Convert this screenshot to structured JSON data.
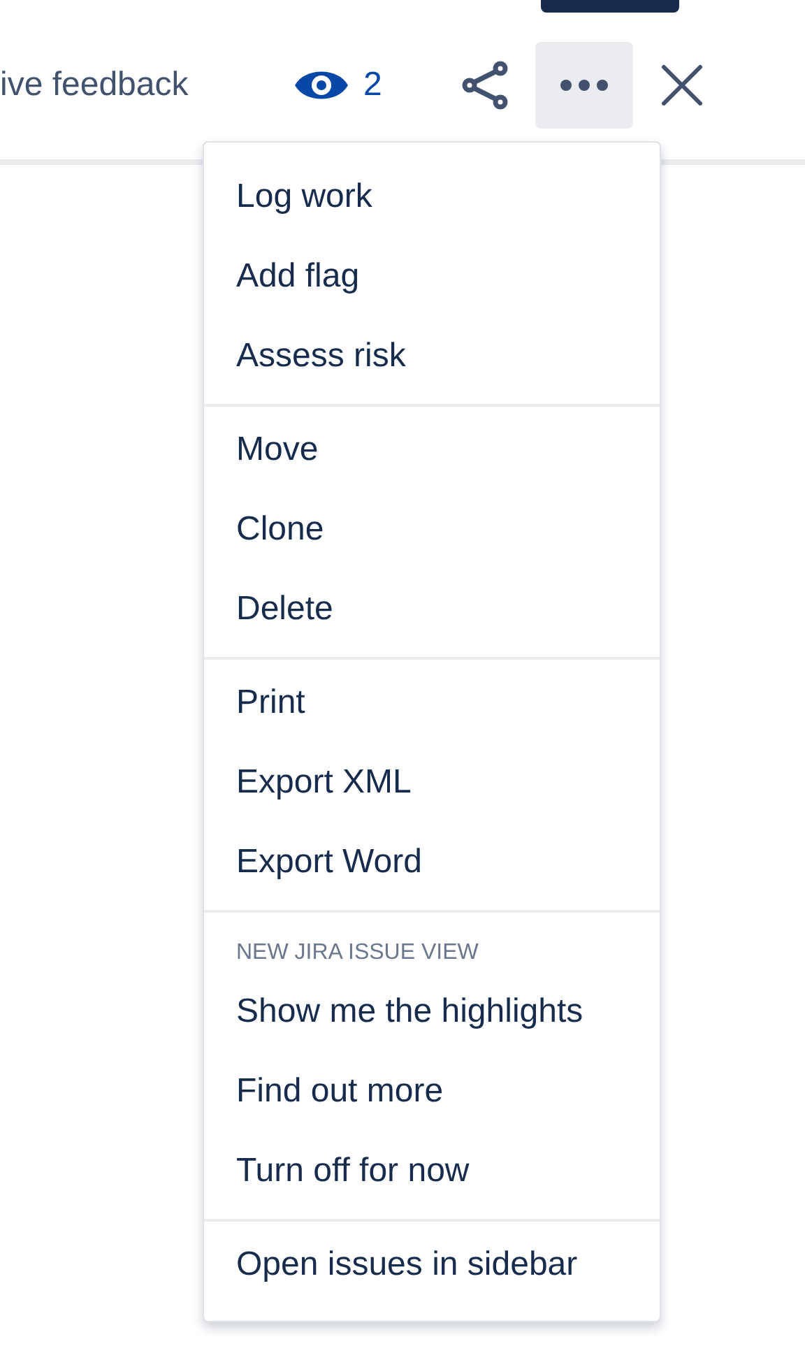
{
  "header": {
    "feedback_link": "ive feedback",
    "watchers": "2",
    "more_selected": true
  },
  "menu": {
    "sections": [
      {
        "items": [
          "Log work",
          "Add flag",
          "Assess risk"
        ]
      },
      {
        "items": [
          "Move",
          "Clone",
          "Delete"
        ]
      },
      {
        "items": [
          "Print",
          "Export XML",
          "Export Word"
        ]
      },
      {
        "heading": "NEW JIRA ISSUE VIEW",
        "items": [
          "Show me the highlights",
          "Find out more",
          "Turn off for now"
        ]
      },
      {
        "items": [
          "Open issues in sidebar"
        ]
      }
    ]
  }
}
